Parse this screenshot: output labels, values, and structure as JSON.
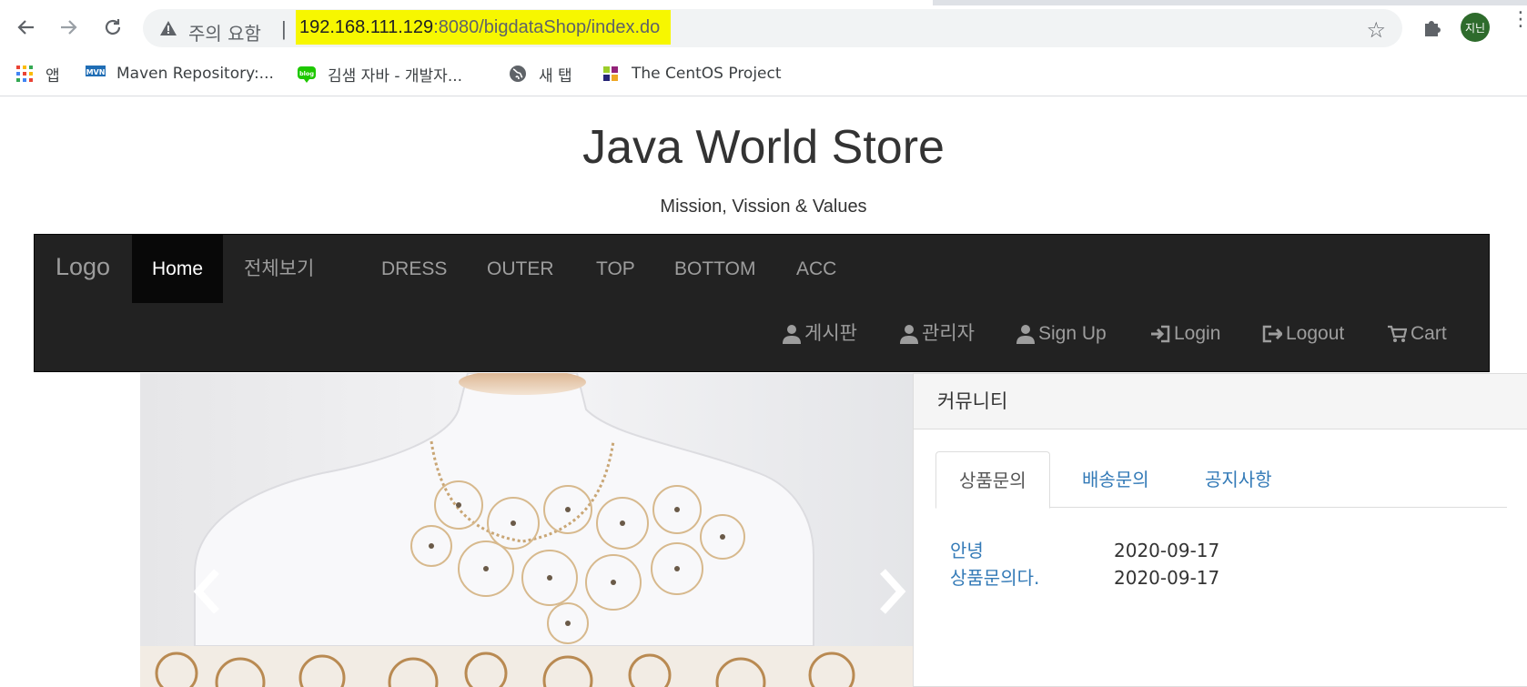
{
  "browser": {
    "security_label": "주의 요함",
    "url_host": "192.168.111.129",
    "url_rest": ":8080/bigdataShop/index.do",
    "profile_initials": "지닌",
    "bookmarks": [
      {
        "label": "앱",
        "icon": "apps-grid-icon"
      },
      {
        "label": "Maven Repository:...",
        "icon": "maven-icon"
      },
      {
        "label": "김샘 자바 - 개발자...",
        "icon": "blog-icon"
      },
      {
        "label": "새 탭",
        "icon": "globe-icon"
      },
      {
        "label": "The CentOS Project",
        "icon": "centos-icon"
      }
    ]
  },
  "site": {
    "title": "Java World Store",
    "subtitle": "Mission, Vission & Values"
  },
  "navbar": {
    "brand": "Logo",
    "items": [
      {
        "label": "Home",
        "active": true
      },
      {
        "label": "전체보기"
      },
      {
        "label": "DRESS"
      },
      {
        "label": "OUTER"
      },
      {
        "label": "TOP"
      },
      {
        "label": "BOTTOM"
      },
      {
        "label": "ACC"
      }
    ],
    "right_items": [
      {
        "label": "게시판",
        "icon": "user-icon"
      },
      {
        "label": "관리자",
        "icon": "user-icon"
      },
      {
        "label": "Sign Up",
        "icon": "user-icon"
      },
      {
        "label": "Login",
        "icon": "login-icon"
      },
      {
        "label": "Logout",
        "icon": "logout-icon"
      },
      {
        "label": "Cart",
        "icon": "cart-icon"
      }
    ]
  },
  "community": {
    "heading": "커뮤니티",
    "tabs": [
      {
        "label": "상품문의",
        "active": true
      },
      {
        "label": "배송문의"
      },
      {
        "label": "공지사항"
      }
    ],
    "rows": [
      {
        "subject": "안녕",
        "date": "2020-09-17"
      },
      {
        "subject": "상품문의다.",
        "date": "2020-09-17"
      }
    ]
  }
}
